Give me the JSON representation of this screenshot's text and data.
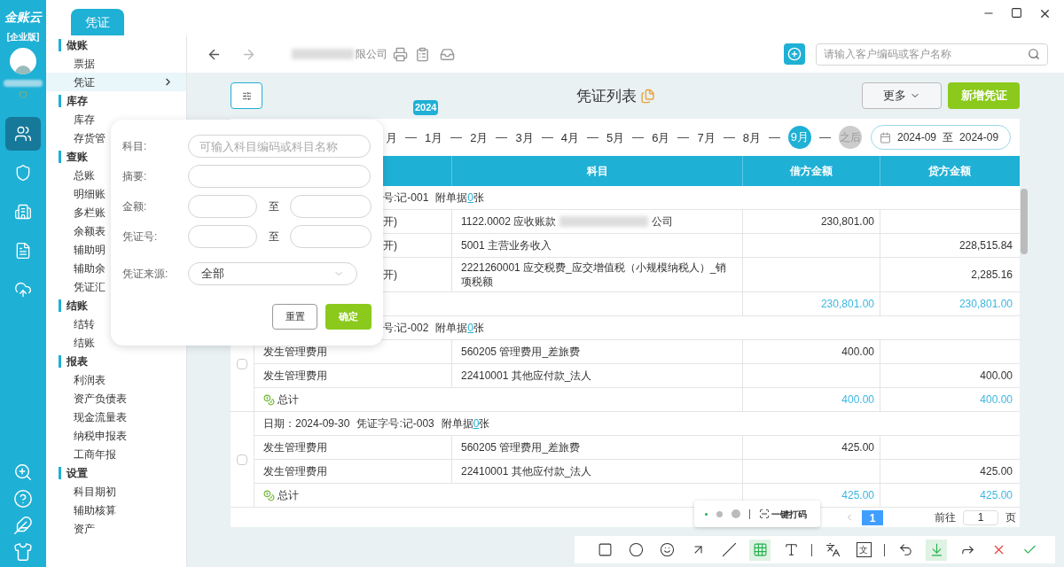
{
  "app": {
    "logo": "金账云",
    "edition": "[企业版]"
  },
  "rail": [
    {
      "kind": "users",
      "selected": true
    },
    {
      "kind": "shield",
      "selected": false
    },
    {
      "kind": "building",
      "selected": false
    },
    {
      "kind": "document",
      "selected": false
    },
    {
      "kind": "cloud",
      "selected": false
    }
  ],
  "rail_bottom": [
    {
      "kind": "zoom"
    },
    {
      "kind": "help"
    },
    {
      "kind": "feather"
    },
    {
      "kind": "shirt"
    }
  ],
  "tabs": [
    {
      "label": "凭证",
      "selected": true
    }
  ],
  "sidebar": [
    {
      "title": "做账",
      "items": [
        {
          "label": "票据",
          "selected": false
        },
        {
          "label": "凭证",
          "selected": true
        }
      ]
    },
    {
      "title": "库存",
      "items": [
        {
          "label": "库存",
          "selected": false
        },
        {
          "label": "存货管",
          "selected": false
        }
      ]
    },
    {
      "title": "查账",
      "items": [
        {
          "label": "总账",
          "selected": false
        },
        {
          "label": "明细账",
          "selected": false
        },
        {
          "label": "多栏账",
          "selected": false
        },
        {
          "label": "余额表",
          "selected": false
        },
        {
          "label": "辅助明",
          "selected": false
        },
        {
          "label": "辅助余",
          "selected": false
        },
        {
          "label": "凭证汇",
          "selected": false
        }
      ]
    },
    {
      "title": "结账",
      "items": [
        {
          "label": "结转",
          "selected": false
        },
        {
          "label": "结账",
          "selected": false
        }
      ]
    },
    {
      "title": "报表",
      "items": [
        {
          "label": "利润表",
          "selected": false
        },
        {
          "label": "资产负债表",
          "selected": false
        },
        {
          "label": "现金流量表",
          "selected": false
        },
        {
          "label": "纳税申报表",
          "selected": false
        },
        {
          "label": "工商年报",
          "selected": false
        }
      ]
    },
    {
      "title": "设置",
      "items": [
        {
          "label": "科目期初",
          "selected": false
        },
        {
          "label": "辅助核算",
          "selected": false
        },
        {
          "label": "资产",
          "selected": false
        }
      ]
    }
  ],
  "toolbar": {
    "company": "限公司",
    "search": {
      "placeholder": "请输入客户编码或客户名称"
    }
  },
  "page": {
    "title": "凭证列表",
    "more": "更多",
    "add": "新增凭证"
  },
  "period": {
    "months": [
      {
        "label": "月",
        "kind": "month",
        "selected": false
      },
      {
        "label": "1月",
        "kind": "month",
        "selected": false,
        "year": "2024"
      },
      {
        "label": "2月",
        "kind": "month",
        "selected": false
      },
      {
        "label": "3月",
        "kind": "month",
        "selected": false
      },
      {
        "label": "4月",
        "kind": "month",
        "selected": false
      },
      {
        "label": "5月",
        "kind": "month",
        "selected": false
      },
      {
        "label": "6月",
        "kind": "month",
        "selected": false
      },
      {
        "label": "7月",
        "kind": "month",
        "selected": false
      },
      {
        "label": "8月",
        "kind": "month",
        "selected": false
      },
      {
        "label": "9月",
        "kind": "month",
        "selected": true
      },
      {
        "label": "之后",
        "kind": "after",
        "selected": false
      }
    ],
    "range": {
      "from": "2024-09",
      "sep": "至",
      "to": "2024-09"
    }
  },
  "table": {
    "columns": [
      "科目",
      "借方金额",
      "贷方金额"
    ],
    "groups": [
      {
        "covered": true,
        "voucher": "号:记-001",
        "attach_prefix": "附单据",
        "attach_count": "0",
        "attach_suffix": "张",
        "rows": [
          {
            "summary": "开)",
            "covered": true,
            "account": "1122.0002 应收账款",
            "redacted": true,
            "account_tail": "公司",
            "debit": "230,801.00"
          },
          {
            "summary": "开)",
            "covered": true,
            "account": "5001 主营业务收入",
            "credit": "228,515.84"
          },
          {
            "summary": "开)",
            "covered": true,
            "account": "2221260001 应交税费_应交增值税（小规模纳税人）_销项税额",
            "credit": "2,285.16"
          }
        ],
        "total": {
          "debit": "230,801.00",
          "credit": "230,801.00"
        }
      },
      {
        "covered": true,
        "voucher": "号:记-002",
        "attach_prefix": "附单据",
        "attach_count": "0",
        "attach_suffix": "张",
        "checked": false,
        "rows": [
          {
            "summary": "发生管理费用",
            "account": "560205 管理费用_差旅费",
            "debit": "400.00"
          },
          {
            "summary": "发生管理费用",
            "account": "22410001 其他应付款_法人",
            "credit": "400.00"
          }
        ],
        "total": {
          "label": "总计",
          "debit": "400.00",
          "credit": "400.00"
        }
      },
      {
        "covered": false,
        "date": "日期：2024-09-30",
        "voucher": "凭证字号:记-003",
        "attach_prefix": "附单据",
        "attach_count": "0",
        "attach_suffix": "张",
        "checked": false,
        "rows": [
          {
            "summary": "发生管理费用",
            "account": "560205 管理费用_差旅费",
            "debit": "425.00"
          },
          {
            "summary": "发生管理费用",
            "account": "22410001 其他应付款_法人",
            "credit": "425.00"
          }
        ],
        "total": {
          "label": "总计",
          "debit": "425.00",
          "credit": "425.00"
        }
      }
    ]
  },
  "pagination": {
    "pages": [
      {
        "label": "1",
        "selected": true
      }
    ],
    "goto": "前往",
    "goto_value": "1",
    "goto_suffix": "页"
  },
  "filter": {
    "fields": [
      {
        "kind": "text",
        "label": "科目:",
        "placeholder": "可输入科目编码或科目名称"
      },
      {
        "kind": "text",
        "label": "摘要:"
      },
      {
        "kind": "range",
        "label": "金额:",
        "sep": "至"
      },
      {
        "kind": "range",
        "label": "凭证号:",
        "sep": "至"
      },
      {
        "kind": "select",
        "label": "凭证来源:",
        "value": "全部"
      }
    ],
    "reset": "重置",
    "confirm": "确定"
  },
  "capture": {
    "sizes": [
      {
        "selected": true
      },
      {
        "selected": false
      },
      {
        "selected": false
      }
    ],
    "action": "一键打码",
    "tools": [
      {
        "kind": "rect",
        "selected": false
      },
      {
        "kind": "circle",
        "selected": false
      },
      {
        "kind": "emoji",
        "selected": false
      },
      {
        "kind": "arrow",
        "selected": false
      },
      {
        "kind": "pen",
        "selected": false
      },
      {
        "kind": "mosaic",
        "selected": true
      },
      {
        "kind": "text",
        "selected": false
      },
      {
        "kind": "divider"
      },
      {
        "kind": "translate",
        "selected": false
      },
      {
        "kind": "ocr",
        "selected": false,
        "glyph": "文"
      },
      {
        "kind": "divider"
      },
      {
        "kind": "undo",
        "selected": false
      },
      {
        "kind": "save",
        "selected": true
      },
      {
        "kind": "share",
        "selected": false
      },
      {
        "kind": "cancel",
        "selected": false
      },
      {
        "kind": "done",
        "selected": false
      }
    ]
  }
}
